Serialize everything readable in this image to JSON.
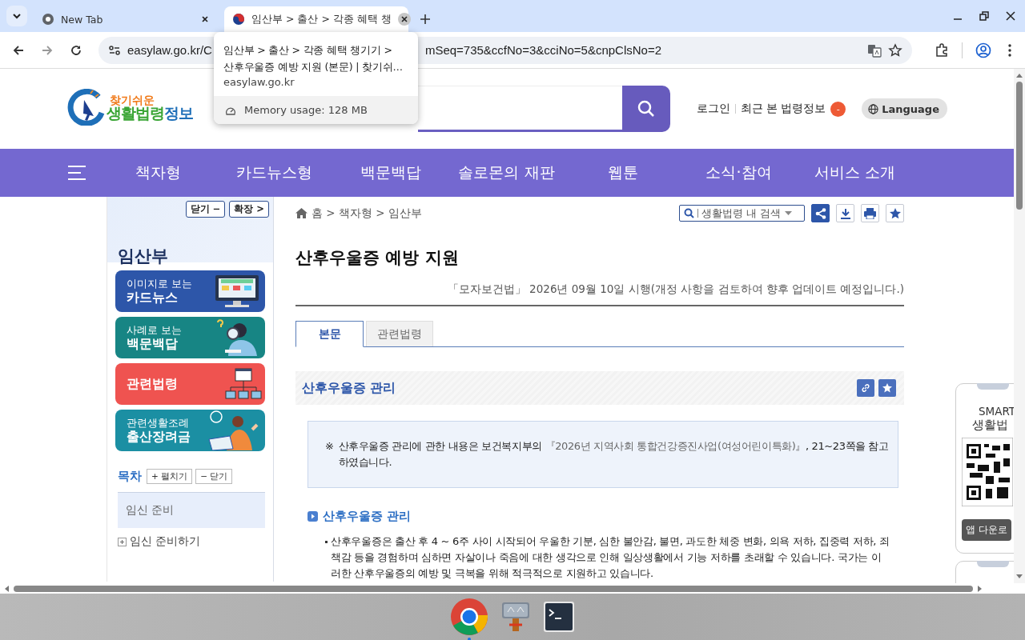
{
  "browser": {
    "tabs": [
      {
        "title": "New Tab",
        "selected": false
      },
      {
        "title": "임산부 > 출산 > 각종 혜택 챙",
        "selected": true
      }
    ],
    "url_start": "easylaw.go.kr/C",
    "url_end": "mSeq=735&ccfNo=3&cciNo=5&cnpClsNo=2",
    "tooltip": {
      "title_lines": [
        "임산부 > 출산 > 각종 혜택 챙기기 >",
        "산후우울증 예방 지원 (본문) | 찾기쉬…"
      ],
      "host": "easylaw.go.kr",
      "memory": "Memory usage: 128 MB"
    }
  },
  "header": {
    "logo": {
      "tagline": "찾기쉬운",
      "name_part_1": "생활법령",
      "name_part_2": "정보"
    },
    "links": [
      "로그인",
      "최근 본 법령정보"
    ],
    "badge": "-",
    "language": "Language"
  },
  "nav": [
    "책자형",
    "카드뉴스형",
    "백문백답",
    "솔로몬의 재판",
    "웹툰",
    "소식·참여",
    "서비스 소개"
  ],
  "sidebar": {
    "controls": [
      {
        "label": "닫기",
        "symbol": "−"
      },
      {
        "label": "확장",
        "symbol": ">"
      }
    ],
    "title": "임산부",
    "cards": [
      {
        "kind": "monitor",
        "small": "이미지로 보는",
        "big": "카드뉴스",
        "color": "#2d56a9"
      },
      {
        "kind": "search",
        "small": "사례로 보는",
        "big": "백문백답",
        "color": "#178584"
      },
      {
        "kind": "law",
        "big": "관련법령",
        "color": "#ef5350"
      },
      {
        "kind": "reader",
        "small": "관련생활조례",
        "big": "출산장려금",
        "color": "#1b8fa3"
      }
    ],
    "toc": {
      "title": "목차",
      "buttons": [
        "+ 펼치기",
        "− 닫기"
      ],
      "sections": [
        {
          "title": "임신 준비",
          "selected": true,
          "children": [
            {
              "label": "임신 준비하기",
              "expanded": false
            }
          ]
        }
      ]
    }
  },
  "main": {
    "breadcrumb": "홈 > 책자형 > 임산부",
    "search_placeholder": "생활법령 내 검색",
    "title": "산후우울증 예방 지원",
    "law_note": "「모자보건법」 2026년 09월 10일 시행(개정 사항을 검토하여 향후 업데이트 예정입니다.)",
    "tabs": [
      {
        "label": "본문",
        "selected": true
      },
      {
        "label": "관련법령",
        "selected": false
      }
    ],
    "section_heading": "산후우울증 관리",
    "notice": {
      "mark": "※",
      "before": "산후우울증 관리에 관한 내용은 보건복지부의 ",
      "source": "『2026년 지역사회 통합건강증진사업(여성어린이특화)』",
      "after": ", 21~23쪽을 참고하였습니다."
    },
    "subheading": "산후우울증 관리",
    "bullets": [
      "산후우울증은 출산 후 4 ~ 6주 사이 시작되어 우울한 기분, 심한 불안감, 불면, 과도한 체중 변화, 의욕 저하, 집중력 저하, 죄책감 등을 경험하며 심하면 자살이나 죽음에 대한 생각으로 인해 일상생활에서 기능 저하를 초래할 수 있습니다. 국가는 이러한 산후우울증의 예방 및 극복을 위해 적극적으로 지원하고 있습니다."
    ]
  },
  "smart_widget": {
    "title_1": "SMART",
    "title_2": "생활법",
    "button": "앱 다운로"
  }
}
